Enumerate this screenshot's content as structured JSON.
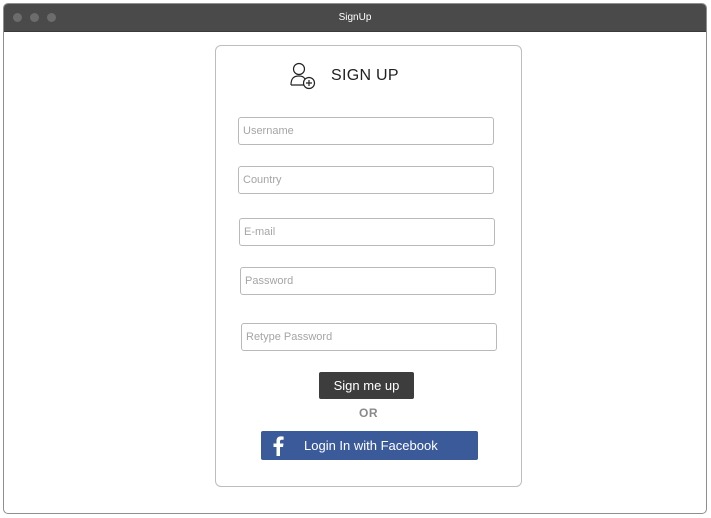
{
  "window": {
    "title": "SignUp"
  },
  "form": {
    "heading": "SIGN UP",
    "heading_icon": "add-user-icon",
    "fields": {
      "username": {
        "placeholder": "Username",
        "value": ""
      },
      "country": {
        "placeholder": "Country",
        "value": ""
      },
      "email": {
        "placeholder": "E-mail",
        "value": ""
      },
      "password": {
        "placeholder": "Password",
        "value": ""
      },
      "retype_password": {
        "placeholder": "Retype Password",
        "value": ""
      }
    },
    "signup_button_label": "Sign me up",
    "separator": "OR",
    "facebook_button_label": "Login In with Facebook",
    "facebook_icon": "facebook-icon"
  },
  "colors": {
    "titlebar": "#4a4a4a",
    "signup_button": "#3d3d3d",
    "facebook_button": "#3b5a9a"
  }
}
